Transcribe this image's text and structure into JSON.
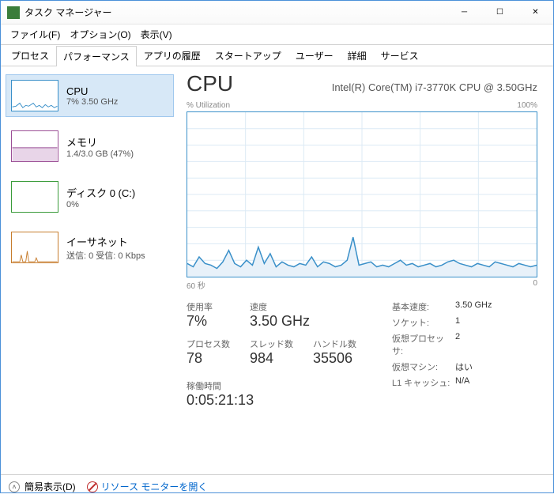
{
  "window": {
    "title": "タスク マネージャー"
  },
  "menu": {
    "file": "ファイル(F)",
    "options": "オプション(O)",
    "view": "表示(V)"
  },
  "tabs": [
    "プロセス",
    "パフォーマンス",
    "アプリの履歴",
    "スタートアップ",
    "ユーザー",
    "詳細",
    "サービス"
  ],
  "active_tab_index": 1,
  "sidebar": [
    {
      "title": "CPU",
      "sub": "7%  3.50 GHz",
      "color": "#3a90c9"
    },
    {
      "title": "メモリ",
      "sub": "1.4/3.0 GB (47%)",
      "color": "#9b4f96"
    },
    {
      "title": "ディスク 0 (C:)",
      "sub": "0%",
      "color": "#3a9b3a"
    },
    {
      "title": "イーサネット",
      "sub": "送信: 0  受信: 0 Kbps",
      "color": "#c77d2e"
    }
  ],
  "detail": {
    "title": "CPU",
    "subtitle": "Intel(R) Core(TM) i7-3770K CPU @ 3.50GHz",
    "chart_top_left": "% Utilization",
    "chart_top_right": "100%",
    "chart_bottom_left": "60 秒",
    "chart_bottom_right": "0"
  },
  "metrics": {
    "usage_label": "使用率",
    "usage_value": "7%",
    "speed_label": "速度",
    "speed_value": "3.50 GHz",
    "processes_label": "プロセス数",
    "processes_value": "78",
    "threads_label": "スレッド数",
    "threads_value": "984",
    "handles_label": "ハンドル数",
    "handles_value": "35506",
    "uptime_label": "稼働時間",
    "uptime_value": "0:05:21:13"
  },
  "right_metrics": [
    {
      "label": "基本速度:",
      "value": "3.50 GHz"
    },
    {
      "label": "ソケット:",
      "value": "1"
    },
    {
      "label": "仮想プロセッサ:",
      "value": "2"
    },
    {
      "label": "仮想マシン:",
      "value": "はい"
    },
    {
      "label": "L1 キャッシュ:",
      "value": "N/A"
    }
  ],
  "status": {
    "fewer_details": "簡易表示(D)",
    "resource_monitor": "リソース モニターを開く"
  },
  "chart_data": {
    "type": "line",
    "title": "% Utilization",
    "ylim": [
      0,
      100
    ],
    "xlabel_left": "60 秒",
    "xlabel_right": "0",
    "values": [
      8,
      6,
      12,
      8,
      7,
      5,
      9,
      16,
      8,
      6,
      10,
      7,
      18,
      8,
      14,
      6,
      9,
      7,
      6,
      8,
      7,
      12,
      6,
      9,
      8,
      6,
      7,
      10,
      24,
      7,
      8,
      9,
      6,
      7,
      6,
      8,
      10,
      7,
      8,
      6,
      7,
      8,
      6,
      7,
      9,
      10,
      8,
      7,
      6,
      8,
      7,
      6,
      9,
      8,
      7,
      6,
      8,
      7,
      6,
      7
    ]
  }
}
